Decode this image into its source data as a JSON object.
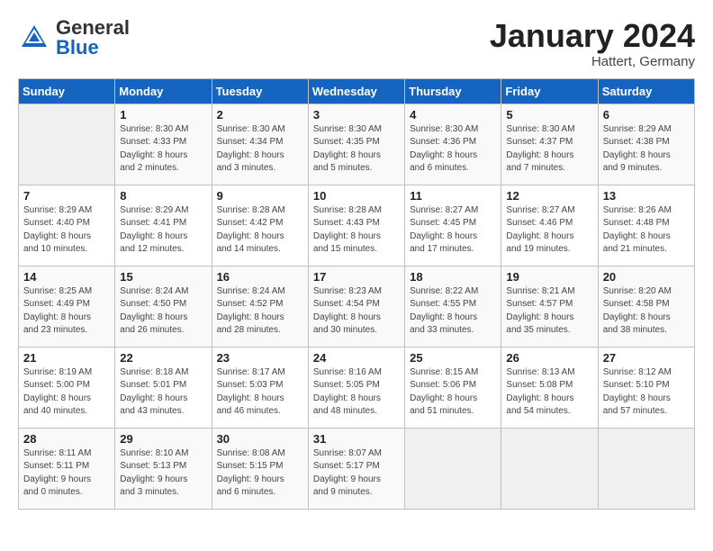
{
  "header": {
    "logo_general": "General",
    "logo_blue": "Blue",
    "title": "January 2024",
    "subtitle": "Hattert, Germany"
  },
  "weekdays": [
    "Sunday",
    "Monday",
    "Tuesday",
    "Wednesday",
    "Thursday",
    "Friday",
    "Saturday"
  ],
  "weeks": [
    [
      {
        "day": "",
        "info": ""
      },
      {
        "day": "1",
        "info": "Sunrise: 8:30 AM\nSunset: 4:33 PM\nDaylight: 8 hours\nand 2 minutes."
      },
      {
        "day": "2",
        "info": "Sunrise: 8:30 AM\nSunset: 4:34 PM\nDaylight: 8 hours\nand 3 minutes."
      },
      {
        "day": "3",
        "info": "Sunrise: 8:30 AM\nSunset: 4:35 PM\nDaylight: 8 hours\nand 5 minutes."
      },
      {
        "day": "4",
        "info": "Sunrise: 8:30 AM\nSunset: 4:36 PM\nDaylight: 8 hours\nand 6 minutes."
      },
      {
        "day": "5",
        "info": "Sunrise: 8:30 AM\nSunset: 4:37 PM\nDaylight: 8 hours\nand 7 minutes."
      },
      {
        "day": "6",
        "info": "Sunrise: 8:29 AM\nSunset: 4:38 PM\nDaylight: 8 hours\nand 9 minutes."
      }
    ],
    [
      {
        "day": "7",
        "info": "Sunrise: 8:29 AM\nSunset: 4:40 PM\nDaylight: 8 hours\nand 10 minutes."
      },
      {
        "day": "8",
        "info": "Sunrise: 8:29 AM\nSunset: 4:41 PM\nDaylight: 8 hours\nand 12 minutes."
      },
      {
        "day": "9",
        "info": "Sunrise: 8:28 AM\nSunset: 4:42 PM\nDaylight: 8 hours\nand 14 minutes."
      },
      {
        "day": "10",
        "info": "Sunrise: 8:28 AM\nSunset: 4:43 PM\nDaylight: 8 hours\nand 15 minutes."
      },
      {
        "day": "11",
        "info": "Sunrise: 8:27 AM\nSunset: 4:45 PM\nDaylight: 8 hours\nand 17 minutes."
      },
      {
        "day": "12",
        "info": "Sunrise: 8:27 AM\nSunset: 4:46 PM\nDaylight: 8 hours\nand 19 minutes."
      },
      {
        "day": "13",
        "info": "Sunrise: 8:26 AM\nSunset: 4:48 PM\nDaylight: 8 hours\nand 21 minutes."
      }
    ],
    [
      {
        "day": "14",
        "info": "Sunrise: 8:25 AM\nSunset: 4:49 PM\nDaylight: 8 hours\nand 23 minutes."
      },
      {
        "day": "15",
        "info": "Sunrise: 8:24 AM\nSunset: 4:50 PM\nDaylight: 8 hours\nand 26 minutes."
      },
      {
        "day": "16",
        "info": "Sunrise: 8:24 AM\nSunset: 4:52 PM\nDaylight: 8 hours\nand 28 minutes."
      },
      {
        "day": "17",
        "info": "Sunrise: 8:23 AM\nSunset: 4:54 PM\nDaylight: 8 hours\nand 30 minutes."
      },
      {
        "day": "18",
        "info": "Sunrise: 8:22 AM\nSunset: 4:55 PM\nDaylight: 8 hours\nand 33 minutes."
      },
      {
        "day": "19",
        "info": "Sunrise: 8:21 AM\nSunset: 4:57 PM\nDaylight: 8 hours\nand 35 minutes."
      },
      {
        "day": "20",
        "info": "Sunrise: 8:20 AM\nSunset: 4:58 PM\nDaylight: 8 hours\nand 38 minutes."
      }
    ],
    [
      {
        "day": "21",
        "info": "Sunrise: 8:19 AM\nSunset: 5:00 PM\nDaylight: 8 hours\nand 40 minutes."
      },
      {
        "day": "22",
        "info": "Sunrise: 8:18 AM\nSunset: 5:01 PM\nDaylight: 8 hours\nand 43 minutes."
      },
      {
        "day": "23",
        "info": "Sunrise: 8:17 AM\nSunset: 5:03 PM\nDaylight: 8 hours\nand 46 minutes."
      },
      {
        "day": "24",
        "info": "Sunrise: 8:16 AM\nSunset: 5:05 PM\nDaylight: 8 hours\nand 48 minutes."
      },
      {
        "day": "25",
        "info": "Sunrise: 8:15 AM\nSunset: 5:06 PM\nDaylight: 8 hours\nand 51 minutes."
      },
      {
        "day": "26",
        "info": "Sunrise: 8:13 AM\nSunset: 5:08 PM\nDaylight: 8 hours\nand 54 minutes."
      },
      {
        "day": "27",
        "info": "Sunrise: 8:12 AM\nSunset: 5:10 PM\nDaylight: 8 hours\nand 57 minutes."
      }
    ],
    [
      {
        "day": "28",
        "info": "Sunrise: 8:11 AM\nSunset: 5:11 PM\nDaylight: 9 hours\nand 0 minutes."
      },
      {
        "day": "29",
        "info": "Sunrise: 8:10 AM\nSunset: 5:13 PM\nDaylight: 9 hours\nand 3 minutes."
      },
      {
        "day": "30",
        "info": "Sunrise: 8:08 AM\nSunset: 5:15 PM\nDaylight: 9 hours\nand 6 minutes."
      },
      {
        "day": "31",
        "info": "Sunrise: 8:07 AM\nSunset: 5:17 PM\nDaylight: 9 hours\nand 9 minutes."
      },
      {
        "day": "",
        "info": ""
      },
      {
        "day": "",
        "info": ""
      },
      {
        "day": "",
        "info": ""
      }
    ]
  ]
}
